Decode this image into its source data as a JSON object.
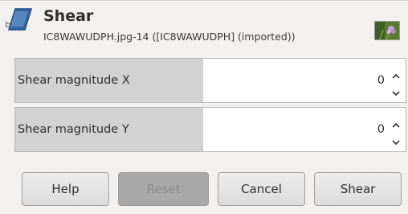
{
  "dialog": {
    "title": "Shear",
    "subtitle": "IC8WAWUDPH.jpg-14 ([IC8WAWUDPH] (imported))",
    "tool_icon": "shear-tool-icon",
    "thumbnail_icon": "image-thumbnail"
  },
  "fields": {
    "magnitude_x": {
      "label": "Shear magnitude X",
      "value": "0"
    },
    "magnitude_y": {
      "label": "Shear magnitude Y",
      "value": "0"
    }
  },
  "buttons": {
    "help": "Help",
    "reset": "Reset",
    "cancel": "Cancel",
    "shear": "Shear"
  },
  "colors": {
    "background": "#f2f1f0",
    "label_area": "#d2d2d2",
    "disabled_button": "#a9a9a9"
  }
}
